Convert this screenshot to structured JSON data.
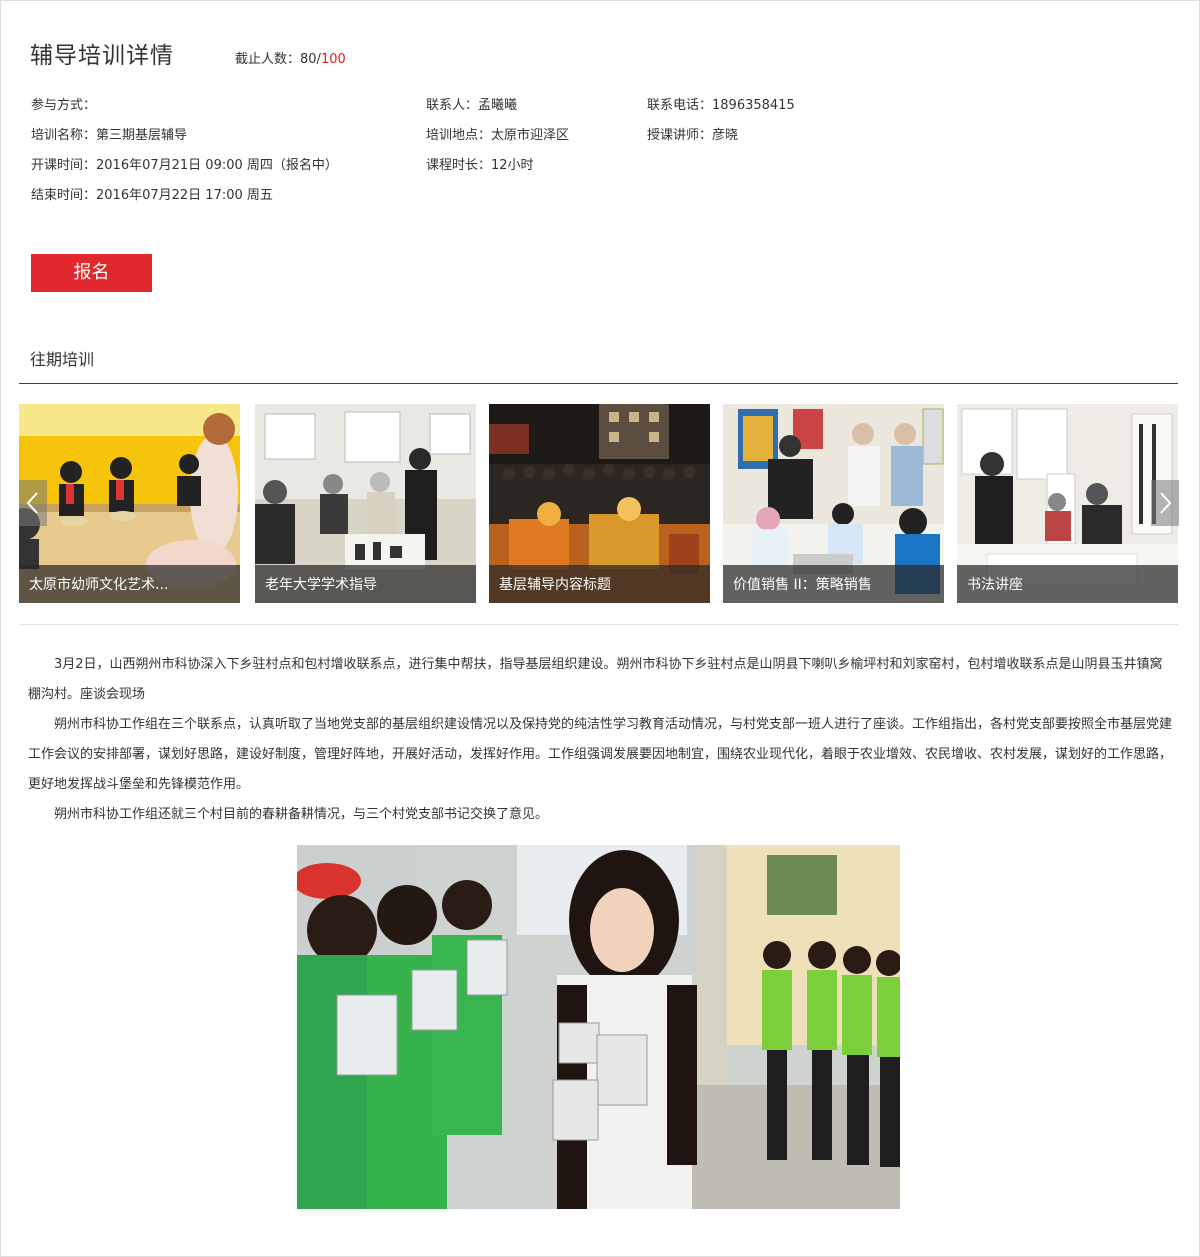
{
  "header": {
    "title": "辅导培训详情",
    "quota_label": "截止人数：80/",
    "quota_max": "100"
  },
  "info": {
    "col1": [
      "参与方式：",
      "培训名称：第三期基层辅导",
      "开课时间：2016年07月21日 09:00 周四（报名中）",
      "结束时间：2016年07月22日 17:00 周五"
    ],
    "col2": [
      "联系人：孟曦曦",
      "培训地点：太原市迎泽区",
      "课程时长：12小时"
    ],
    "col3": [
      "联系电话：1896358415",
      "授课讲师：彦晓"
    ]
  },
  "signup_label": "报名",
  "past": {
    "title": "往期培训",
    "cards": [
      {
        "caption": "太原市幼师文化艺术...",
        "icon": "photo-kindergarten-class"
      },
      {
        "caption": "老年大学学术指导",
        "icon": "photo-elderly-university"
      },
      {
        "caption": "基层辅导内容标题",
        "icon": "photo-night-gathering"
      },
      {
        "caption": "价值销售 II：策略销售",
        "icon": "photo-meeting-room"
      },
      {
        "caption": "书法讲座",
        "icon": "photo-calligraphy"
      }
    ]
  },
  "article": {
    "paragraphs": [
      "3月2日，山西朔州市科协深入下乡驻村点和包村增收联系点，进行集中帮扶，指导基层组织建设。朔州市科协下乡驻村点是山阴县下喇叭乡榆坪村和刘家窑村，包村增收联系点是山阴县玉井镇窝棚沟村。座谈会现场",
      "朔州市科协工作组在三个联系点，认真听取了当地党支部的基层组织建设情况以及保持党的纯洁性学习教育活动情况，与村党支部一班人进行了座谈。工作组指出，各村党支部要按照全市基层党建工作会议的安排部署，谋划好思路，建设好制度，管理好阵地，开展好活动，发挥好作用。工作组强调发展要因地制宜，围绕农业现代化，着眼于农业增效、农民增收、农村发展，谋划好的工作思路，更好地发挥战斗堡垒和先锋模范作用。",
      "朔州市科协工作组还就三个村目前的春耕备耕情况，与三个村党支部书记交换了意见。"
    ]
  },
  "colors": {
    "accent_red": "#e0282e",
    "rule_red": "#8b2020",
    "text": "#333333"
  }
}
